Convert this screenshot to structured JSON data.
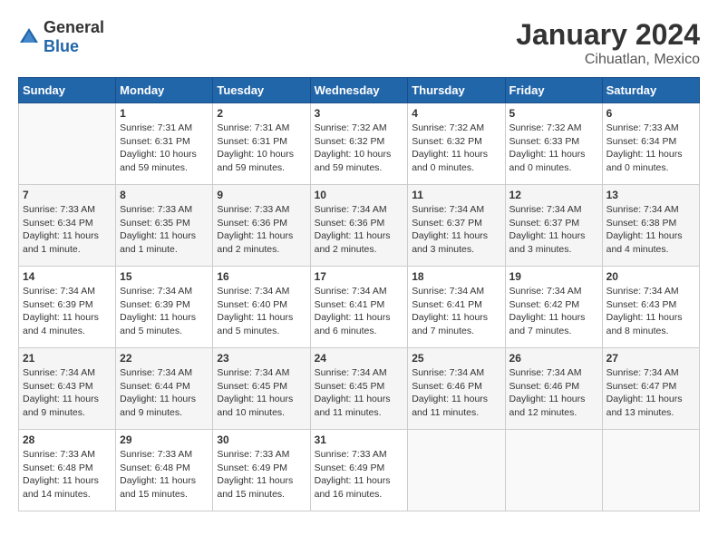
{
  "header": {
    "logo": {
      "general": "General",
      "blue": "Blue"
    },
    "title": "January 2024",
    "subtitle": "Cihuatlan, Mexico"
  },
  "calendar": {
    "weekdays": [
      "Sunday",
      "Monday",
      "Tuesday",
      "Wednesday",
      "Thursday",
      "Friday",
      "Saturday"
    ],
    "weeks": [
      [
        {
          "day": "",
          "info": ""
        },
        {
          "day": "1",
          "info": "Sunrise: 7:31 AM\nSunset: 6:31 PM\nDaylight: 10 hours\nand 59 minutes."
        },
        {
          "day": "2",
          "info": "Sunrise: 7:31 AM\nSunset: 6:31 PM\nDaylight: 10 hours\nand 59 minutes."
        },
        {
          "day": "3",
          "info": "Sunrise: 7:32 AM\nSunset: 6:32 PM\nDaylight: 10 hours\nand 59 minutes."
        },
        {
          "day": "4",
          "info": "Sunrise: 7:32 AM\nSunset: 6:32 PM\nDaylight: 11 hours\nand 0 minutes."
        },
        {
          "day": "5",
          "info": "Sunrise: 7:32 AM\nSunset: 6:33 PM\nDaylight: 11 hours\nand 0 minutes."
        },
        {
          "day": "6",
          "info": "Sunrise: 7:33 AM\nSunset: 6:34 PM\nDaylight: 11 hours\nand 0 minutes."
        }
      ],
      [
        {
          "day": "7",
          "info": "Sunrise: 7:33 AM\nSunset: 6:34 PM\nDaylight: 11 hours\nand 1 minute."
        },
        {
          "day": "8",
          "info": "Sunrise: 7:33 AM\nSunset: 6:35 PM\nDaylight: 11 hours\nand 1 minute."
        },
        {
          "day": "9",
          "info": "Sunrise: 7:33 AM\nSunset: 6:36 PM\nDaylight: 11 hours\nand 2 minutes."
        },
        {
          "day": "10",
          "info": "Sunrise: 7:34 AM\nSunset: 6:36 PM\nDaylight: 11 hours\nand 2 minutes."
        },
        {
          "day": "11",
          "info": "Sunrise: 7:34 AM\nSunset: 6:37 PM\nDaylight: 11 hours\nand 3 minutes."
        },
        {
          "day": "12",
          "info": "Sunrise: 7:34 AM\nSunset: 6:37 PM\nDaylight: 11 hours\nand 3 minutes."
        },
        {
          "day": "13",
          "info": "Sunrise: 7:34 AM\nSunset: 6:38 PM\nDaylight: 11 hours\nand 4 minutes."
        }
      ],
      [
        {
          "day": "14",
          "info": "Sunrise: 7:34 AM\nSunset: 6:39 PM\nDaylight: 11 hours\nand 4 minutes."
        },
        {
          "day": "15",
          "info": "Sunrise: 7:34 AM\nSunset: 6:39 PM\nDaylight: 11 hours\nand 5 minutes."
        },
        {
          "day": "16",
          "info": "Sunrise: 7:34 AM\nSunset: 6:40 PM\nDaylight: 11 hours\nand 5 minutes."
        },
        {
          "day": "17",
          "info": "Sunrise: 7:34 AM\nSunset: 6:41 PM\nDaylight: 11 hours\nand 6 minutes."
        },
        {
          "day": "18",
          "info": "Sunrise: 7:34 AM\nSunset: 6:41 PM\nDaylight: 11 hours\nand 7 minutes."
        },
        {
          "day": "19",
          "info": "Sunrise: 7:34 AM\nSunset: 6:42 PM\nDaylight: 11 hours\nand 7 minutes."
        },
        {
          "day": "20",
          "info": "Sunrise: 7:34 AM\nSunset: 6:43 PM\nDaylight: 11 hours\nand 8 minutes."
        }
      ],
      [
        {
          "day": "21",
          "info": "Sunrise: 7:34 AM\nSunset: 6:43 PM\nDaylight: 11 hours\nand 9 minutes."
        },
        {
          "day": "22",
          "info": "Sunrise: 7:34 AM\nSunset: 6:44 PM\nDaylight: 11 hours\nand 9 minutes."
        },
        {
          "day": "23",
          "info": "Sunrise: 7:34 AM\nSunset: 6:45 PM\nDaylight: 11 hours\nand 10 minutes."
        },
        {
          "day": "24",
          "info": "Sunrise: 7:34 AM\nSunset: 6:45 PM\nDaylight: 11 hours\nand 11 minutes."
        },
        {
          "day": "25",
          "info": "Sunrise: 7:34 AM\nSunset: 6:46 PM\nDaylight: 11 hours\nand 11 minutes."
        },
        {
          "day": "26",
          "info": "Sunrise: 7:34 AM\nSunset: 6:46 PM\nDaylight: 11 hours\nand 12 minutes."
        },
        {
          "day": "27",
          "info": "Sunrise: 7:34 AM\nSunset: 6:47 PM\nDaylight: 11 hours\nand 13 minutes."
        }
      ],
      [
        {
          "day": "28",
          "info": "Sunrise: 7:33 AM\nSunset: 6:48 PM\nDaylight: 11 hours\nand 14 minutes."
        },
        {
          "day": "29",
          "info": "Sunrise: 7:33 AM\nSunset: 6:48 PM\nDaylight: 11 hours\nand 15 minutes."
        },
        {
          "day": "30",
          "info": "Sunrise: 7:33 AM\nSunset: 6:49 PM\nDaylight: 11 hours\nand 15 minutes."
        },
        {
          "day": "31",
          "info": "Sunrise: 7:33 AM\nSunset: 6:49 PM\nDaylight: 11 hours\nand 16 minutes."
        },
        {
          "day": "",
          "info": ""
        },
        {
          "day": "",
          "info": ""
        },
        {
          "day": "",
          "info": ""
        }
      ]
    ]
  }
}
